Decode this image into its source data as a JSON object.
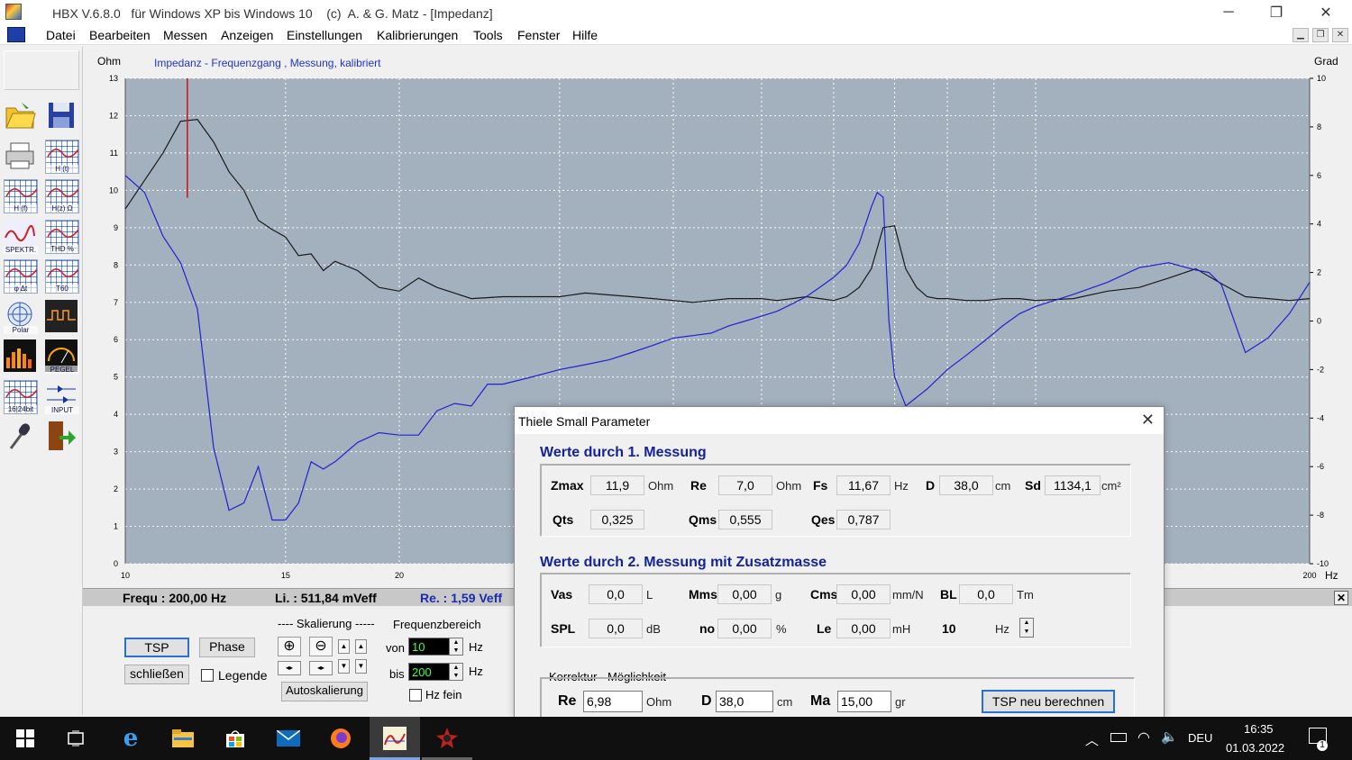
{
  "window": {
    "title": "HBX V.6.8.0   für Windows XP bis Windows 10    (c)  A. & G. Matz - [Impedanz]",
    "minimize": "─",
    "maximize": "❐",
    "close": "✕"
  },
  "menu": {
    "items": [
      "Datei",
      "Bearbeiten",
      "Messen",
      "Anzeigen",
      "Einstellungen",
      "Kalibrierungen",
      "Tools",
      "Fenster",
      "Hilfe"
    ],
    "mdi_min": "▁",
    "mdi_restore": "❐",
    "mdi_close": "✕"
  },
  "toolbar": {
    "tools": [
      {
        "name": "open-folder-icon",
        "label": ""
      },
      {
        "name": "save-icon",
        "label": ""
      },
      {
        "name": "printer-icon",
        "label": ""
      },
      {
        "name": "impulse-response-icon",
        "label": "H (t)"
      },
      {
        "name": "frequency-response-icon",
        "label": "H (f)"
      },
      {
        "name": "impedance-icon",
        "label": "H(z) Ω"
      },
      {
        "name": "spectrum-icon",
        "label": "SPEKTR."
      },
      {
        "name": "thd-icon",
        "label": "THD %"
      },
      {
        "name": "waterfall-icon",
        "label": "φ Δt"
      },
      {
        "name": "t60-icon",
        "label": "T60"
      },
      {
        "name": "polar-icon",
        "label": "Polar"
      },
      {
        "name": "oscilloscope-icon",
        "label": ""
      },
      {
        "name": "bargraph-icon",
        "label": ""
      },
      {
        "name": "level-meter-icon",
        "label": "PEGEL"
      },
      {
        "name": "bit-analyzer-icon",
        "label": "16|24bit"
      },
      {
        "name": "input-icon",
        "label": "INPUT"
      },
      {
        "name": "microphone-icon",
        "label": ""
      },
      {
        "name": "exit-door-icon",
        "label": ""
      }
    ]
  },
  "chart": {
    "left_unit": "Ohm",
    "right_unit": "Grad",
    "x_unit": "Hz",
    "title": "Impedanz - Frequenzgang , Messung, kalibriert",
    "colors": {
      "plot_bg": "#a3b1bf",
      "impedance": "#1a1a1a",
      "phase": "#2222d0",
      "marker": "#d01010",
      "grid": "#ffffff",
      "title": "#2233cc"
    }
  },
  "chart_data": {
    "type": "line",
    "x_scale": "log",
    "xlim": [
      10,
      200
    ],
    "ylim": [
      0,
      13
    ],
    "y2lim": [
      -10,
      10
    ],
    "x_ticks": [
      10,
      15,
      20,
      200
    ],
    "y_ticks": [
      0,
      1,
      2,
      3,
      4,
      5,
      6,
      7,
      8,
      9,
      10,
      11,
      12,
      13
    ],
    "y2_ticks": [
      -10,
      -8,
      -6,
      -4,
      -2,
      0,
      2,
      4,
      6,
      8,
      10
    ],
    "marker_x": 11.7,
    "series": [
      {
        "axis": "left",
        "color": "#1a1a1a",
        "x": [
          10,
          11,
          11.5,
          12,
          12.5,
          13,
          13.5,
          14,
          14.5,
          15,
          15.5,
          16,
          16.5,
          17,
          18,
          19,
          20,
          21,
          22,
          24,
          26,
          28,
          30,
          32,
          34,
          36,
          38,
          40,
          42,
          44,
          46,
          48,
          50,
          52,
          54,
          56,
          58,
          60,
          62,
          64,
          66,
          68,
          70,
          72,
          74,
          76,
          78,
          80,
          84,
          88,
          92,
          96,
          100,
          110,
          120,
          130,
          140,
          150,
          160,
          170,
          180,
          190,
          200
        ],
        "y": [
          9.5,
          11.0,
          11.85,
          11.9,
          11.3,
          10.5,
          10.0,
          9.2,
          8.95,
          8.75,
          8.25,
          8.3,
          7.85,
          8.1,
          7.85,
          7.4,
          7.3,
          7.65,
          7.4,
          7.1,
          7.15,
          7.15,
          7.15,
          7.25,
          7.2,
          7.15,
          7.1,
          7.05,
          7.0,
          7.05,
          7.1,
          7.1,
          7.1,
          7.05,
          7.1,
          7.15,
          7.1,
          7.05,
          7.15,
          7.4,
          7.9,
          9.0,
          9.05,
          7.9,
          7.4,
          7.15,
          7.1,
          7.1,
          7.05,
          7.05,
          7.1,
          7.1,
          7.05,
          7.1,
          7.3,
          7.4,
          7.65,
          7.9,
          7.5,
          7.15,
          7.1,
          7.05,
          7.1
        ]
      },
      {
        "axis": "right",
        "color": "#2222d0",
        "x": [
          10,
          10.5,
          11,
          11.5,
          12,
          12.5,
          13,
          13.5,
          14,
          14.5,
          15,
          15.5,
          16,
          16.5,
          17,
          18,
          19,
          20,
          21,
          22,
          23,
          24,
          25,
          26,
          28,
          30,
          32,
          34,
          36,
          38,
          40,
          42,
          44,
          46,
          48,
          50,
          52,
          54,
          56,
          58,
          60,
          62,
          64,
          66,
          67,
          68,
          69,
          70,
          72,
          76,
          80,
          84,
          88,
          92,
          96,
          100,
          110,
          120,
          130,
          140,
          150,
          155,
          160,
          170,
          180,
          190,
          200
        ],
        "y": [
          6.0,
          5.3,
          3.5,
          2.4,
          0.5,
          -5.2,
          -7.8,
          -7.5,
          -6.0,
          -8.2,
          -8.2,
          -7.5,
          -5.8,
          -6.1,
          -5.8,
          -5.0,
          -4.6,
          -4.7,
          -4.7,
          -3.7,
          -3.4,
          -3.5,
          -2.6,
          -2.6,
          -2.3,
          -2.0,
          -1.8,
          -1.6,
          -1.3,
          -1.0,
          -0.7,
          -0.6,
          -0.5,
          -0.2,
          0.0,
          0.2,
          0.4,
          0.7,
          1.0,
          1.4,
          1.8,
          2.3,
          3.2,
          4.7,
          5.3,
          5.1,
          0.0,
          -2.3,
          -3.5,
          -2.8,
          -2.0,
          -1.4,
          -0.8,
          -0.2,
          0.3,
          0.6,
          1.1,
          1.6,
          2.2,
          2.4,
          2.1,
          2.0,
          1.5,
          -1.3,
          -0.7,
          0.3,
          1.6
        ]
      }
    ]
  },
  "status": {
    "frequ": "Frequ : 200,00 Hz",
    "li": "Li. : 511,84 mVeff",
    "re": "Re. : 1,59 Veff",
    "close": "✕"
  },
  "controls": {
    "tsp_button": "TSP",
    "phase_button": "Phase",
    "close_button": "schließen",
    "legend_label": "Legende",
    "scaling_label": "---- Skalierung -----",
    "autoscale_button": "Autoskalierung",
    "freq_range_label": "Frequenzbereich",
    "from_label": "von",
    "from_value": "10",
    "to_label": "bis",
    "to_value": "200",
    "hz_unit": "Hz",
    "hz_fine_label": "Hz fein"
  },
  "tsp_dialog": {
    "title": "Thiele Small Parameter",
    "close": "✕",
    "section1_title": "Werte durch 1. Messung",
    "section2_title": "Werte durch 2. Messung mit Zusatzmasse",
    "zmax": {
      "label": "Zmax",
      "value": "11,9",
      "unit": "Ohm"
    },
    "re": {
      "label": "Re",
      "value": "7,0",
      "unit": "Ohm"
    },
    "fs": {
      "label": "Fs",
      "value": "11,67",
      "unit": "Hz"
    },
    "d": {
      "label": "D",
      "value": "38,0",
      "unit": "cm"
    },
    "sd": {
      "label": "Sd",
      "value": "1134,1",
      "unit": "cm²"
    },
    "qts": {
      "label": "Qts",
      "value": "0,325"
    },
    "qms": {
      "label": "Qms",
      "value": "0,555"
    },
    "qes": {
      "label": "Qes",
      "value": "0,787"
    },
    "vas": {
      "label": "Vas",
      "value": "0,0",
      "unit": "L"
    },
    "mms": {
      "label": "Mms",
      "value": "0,00",
      "unit": "g"
    },
    "cms": {
      "label": "Cms",
      "value": "0,00",
      "unit": "mm/N"
    },
    "bl": {
      "label": "BL",
      "value": "0,0",
      "unit": "Tm"
    },
    "spl": {
      "label": "SPL",
      "value": "0,0",
      "unit": "dB"
    },
    "no": {
      "label": "no",
      "value": "0,00",
      "unit": "%"
    },
    "le": {
      "label": "Le",
      "value": "0,00",
      "unit": "mH"
    },
    "le_freq": {
      "value": "10",
      "unit": "Hz"
    },
    "correction_title": "Korrektur - Möglichkeit",
    "corr_re": {
      "label": "Re",
      "value": "6,98",
      "unit": "Ohm"
    },
    "corr_d": {
      "label": "D",
      "value": "38,0",
      "unit": "cm"
    },
    "corr_ma": {
      "label": "Ma",
      "value": "15,00",
      "unit": "gr"
    },
    "recalc_button": "TSP neu berechnen"
  },
  "taskbar": {
    "language": "DEU",
    "time": "16:35",
    "date": "01.03.2022",
    "notification_count": "1"
  }
}
